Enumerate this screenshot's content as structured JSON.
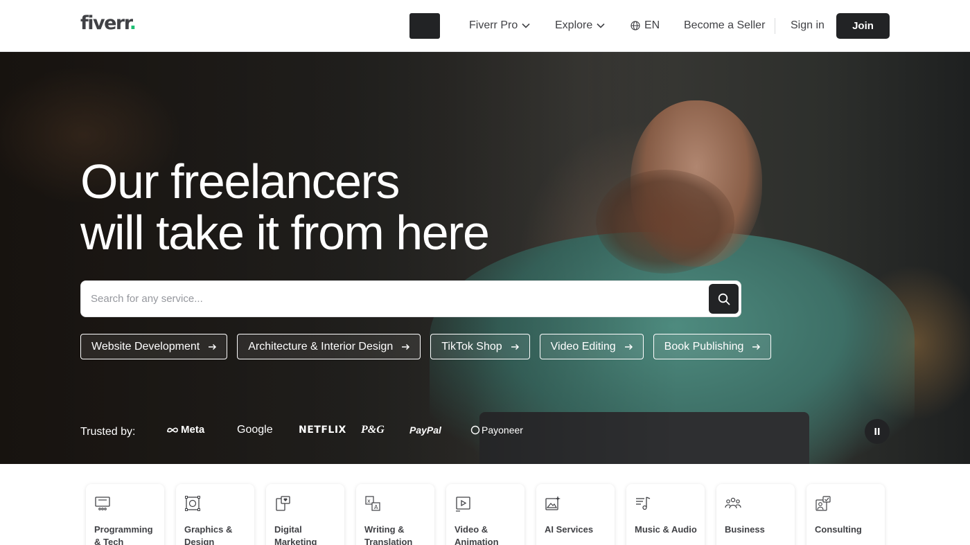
{
  "header": {
    "logo_text": "fiverr",
    "logo_dot": ".",
    "nav": {
      "fiverr_pro": "Fiverr Pro",
      "explore": "Explore",
      "language": "EN",
      "become_seller": "Become a Seller",
      "sign_in": "Sign in",
      "join": "Join"
    }
  },
  "hero": {
    "headline_line1": "Our freelancers",
    "headline_line2": "will take it from here",
    "search_placeholder": "Search for any service...",
    "chips": [
      "Website Development",
      "Architecture & Interior Design",
      "TikTok Shop",
      "Video Editing",
      "Book Publishing"
    ],
    "trusted_label": "Trusted by:",
    "trusted_logos": [
      "Meta",
      "Google",
      "NETFLIX",
      "P&G",
      "PayPal",
      "Payoneer"
    ]
  },
  "categories": [
    {
      "label": "Programming & Tech",
      "icon": "monitor-icon"
    },
    {
      "label": "Graphics & Design",
      "icon": "design-icon"
    },
    {
      "label": "Digital Marketing",
      "icon": "marketing-icon"
    },
    {
      "label": "Writing & Translation",
      "icon": "translation-icon"
    },
    {
      "label": "Video & Animation",
      "icon": "video-icon"
    },
    {
      "label": "AI Services",
      "icon": "ai-icon"
    },
    {
      "label": "Music & Audio",
      "icon": "music-icon"
    },
    {
      "label": "Business",
      "icon": "business-icon"
    },
    {
      "label": "Consulting",
      "icon": "consulting-icon"
    }
  ],
  "colors": {
    "brand_green": "#1dbf73",
    "dark": "#222325",
    "text": "#404145"
  }
}
